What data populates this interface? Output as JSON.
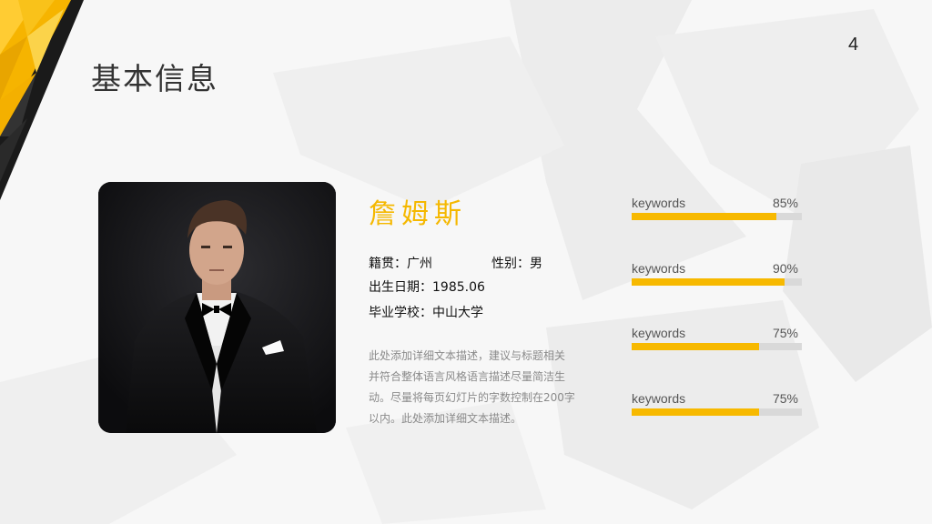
{
  "slide": {
    "page_number": "4",
    "title": "基本信息"
  },
  "profile": {
    "name": "詹姆斯",
    "native_place_label": "籍贯：",
    "native_place_value": "广州",
    "gender_label": "性别：",
    "gender_value": "男",
    "birth_label": "出生日期：",
    "birth_value": "1985.06",
    "school_label": "毕业学校：",
    "school_value": "中山大学",
    "description_lines": [
      "此处添加详细文本描述，建议与标题相关",
      "并符合整体语言风格语言描述尽量简洁生",
      "动。尽量将每页幻灯片的字数控制在200字",
      "以内。此处添加详细文本描述。"
    ]
  },
  "skills": [
    {
      "label": "keywords",
      "percent_text": "85%",
      "value": 0.85
    },
    {
      "label": "keywords",
      "percent_text": "90%",
      "value": 0.9
    },
    {
      "label": "keywords",
      "percent_text": "75%",
      "value": 0.75
    },
    {
      "label": "keywords",
      "percent_text": "75%",
      "value": 0.75
    }
  ],
  "colors": {
    "accent": "#f7b900",
    "track": "#d9d9d9",
    "title": "#333333"
  }
}
